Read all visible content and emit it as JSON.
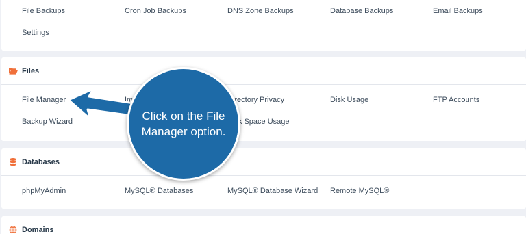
{
  "backup": {
    "items": [
      "File Backups",
      "Cron Job Backups",
      "DNS Zone Backups",
      "Database Backups",
      "Email Backups",
      "Settings"
    ]
  },
  "files": {
    "title": "Files",
    "items": [
      "File Manager",
      "Im",
      "Directory Privacy",
      "Disk Usage",
      "FTP Accounts",
      "Backup Wizard",
      "",
      "Disk Space Usage"
    ]
  },
  "databases": {
    "title": "Databases",
    "items": [
      "phpMyAdmin",
      "MySQL® Databases",
      "MySQL® Database Wizard",
      "Remote MySQL®"
    ]
  },
  "domains": {
    "title": "Domains"
  },
  "callout": {
    "text": "Click on the File Manager option."
  },
  "colors": {
    "accent": "#f0703a",
    "callout_bg": "#1d6aa7"
  },
  "icons": {
    "files": "folder-open-icon",
    "databases": "database-icon",
    "domains": "globe-icon"
  }
}
